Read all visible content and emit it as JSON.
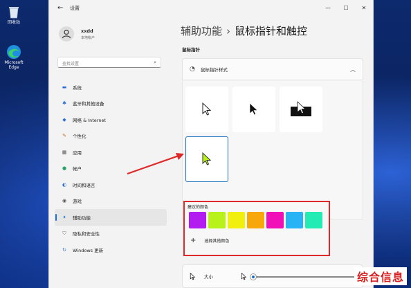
{
  "desktop": {
    "icons": [
      {
        "label": "回收站",
        "icon": "recycle-bin-icon"
      },
      {
        "label": "Microsoft Edge",
        "icon": "edge-icon"
      }
    ]
  },
  "window": {
    "title": "设置",
    "back_icon": "back-arrow-icon",
    "controls": [
      "minimize",
      "maximize",
      "close"
    ]
  },
  "user": {
    "name": "xxdd",
    "subtitle": "本地帐户"
  },
  "search": {
    "placeholder": "查找设置"
  },
  "nav": {
    "items": [
      {
        "label": "系统",
        "icon": "monitor-icon",
        "active": false
      },
      {
        "label": "蓝牙和其他设备",
        "icon": "bluetooth-icon",
        "active": false
      },
      {
        "label": "网络 & Internet",
        "icon": "wifi-icon",
        "active": false
      },
      {
        "label": "个性化",
        "icon": "brush-icon",
        "active": false
      },
      {
        "label": "应用",
        "icon": "apps-icon",
        "active": false
      },
      {
        "label": "帐户",
        "icon": "person-icon",
        "active": false
      },
      {
        "label": "时间和语言",
        "icon": "globe-clock-icon",
        "active": false
      },
      {
        "label": "游戏",
        "icon": "gamepad-icon",
        "active": false
      },
      {
        "label": "辅助功能",
        "icon": "accessibility-icon",
        "active": true
      },
      {
        "label": "隐私和安全性",
        "icon": "shield-icon",
        "active": false
      },
      {
        "label": "Windows 更新",
        "icon": "update-icon",
        "active": false
      }
    ]
  },
  "main": {
    "breadcrumb_parent": "辅助功能",
    "breadcrumb_separator": "›",
    "breadcrumb_current": "鼠标指针和触控",
    "section_label": "鼠标指针",
    "pointer_style": {
      "label": "鼠标指针样式",
      "options": [
        "white",
        "black",
        "inverted",
        "custom"
      ],
      "selected": "custom"
    },
    "recommended_colors": {
      "title": "建议的颜色",
      "swatches": [
        "#b21cf0",
        "#b9f21a",
        "#f1ef0e",
        "#f8a70b",
        "#f10fb8",
        "#27b3f4",
        "#22ecb3"
      ],
      "other_label": "选择其他颜色"
    },
    "size": {
      "label": "大小",
      "value": 1
    }
  },
  "watermark": "综合信息",
  "colors": {
    "accent": "#1a6fc4",
    "highlight": "#e02828"
  }
}
